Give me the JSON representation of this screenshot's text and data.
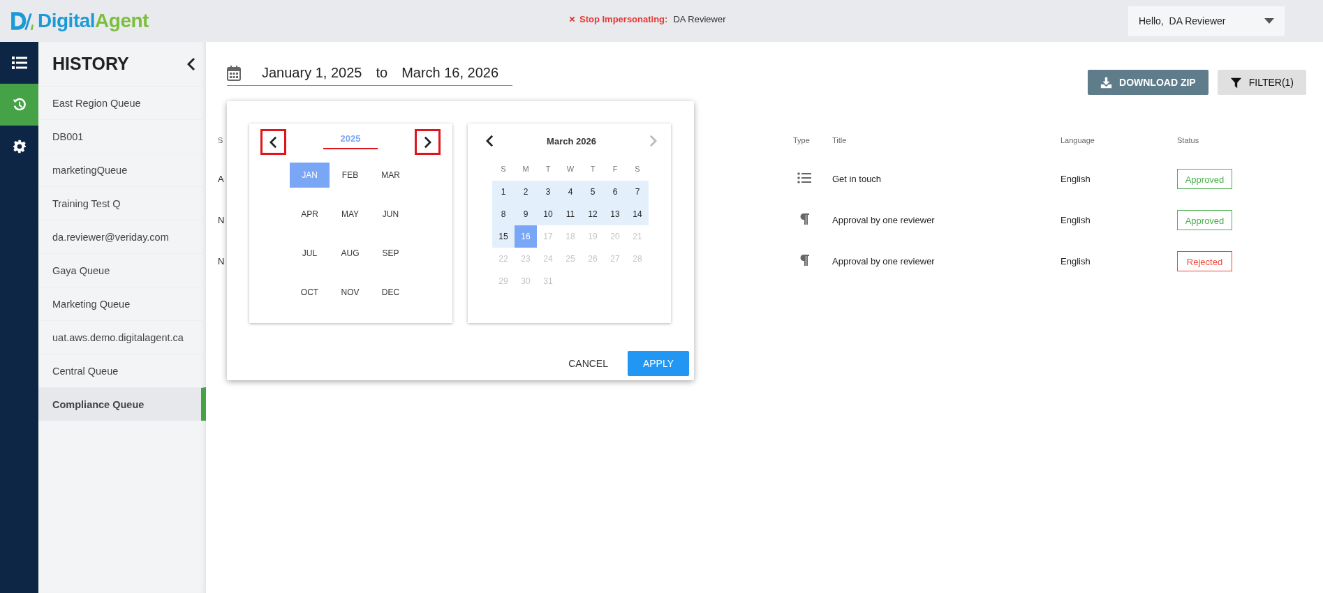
{
  "header": {
    "logo": {
      "parts": [
        "Digital",
        "Agent"
      ]
    },
    "impersonation": {
      "label": "Stop Impersonating:",
      "user": "DA Reviewer"
    },
    "user_menu": {
      "label": "Hello,  DA Reviewer"
    }
  },
  "nav_rail": [
    {
      "kind": "list",
      "selected": false
    },
    {
      "kind": "history",
      "selected": true
    },
    {
      "kind": "settings",
      "selected": false
    }
  ],
  "sidebar": {
    "title": "HISTORY",
    "items": [
      {
        "label": "East Region Queue",
        "selected": false
      },
      {
        "label": "DB001",
        "selected": false
      },
      {
        "label": "marketingQueue",
        "selected": false
      },
      {
        "label": "Training Test Q",
        "selected": false
      },
      {
        "label": "da.reviewer@veriday.com",
        "selected": false
      },
      {
        "label": "Gaya Queue",
        "selected": false
      },
      {
        "label": "Marketing Queue",
        "selected": false
      },
      {
        "label": "uat.aws.demo.digitalagent.ca",
        "selected": false
      },
      {
        "label": "Central Queue",
        "selected": false
      },
      {
        "label": "Compliance Queue",
        "selected": true
      }
    ]
  },
  "date_range": {
    "start": "January 1, 2025",
    "separator": "to",
    "end": "March 16, 2026"
  },
  "buttons": [
    {
      "kind": "download",
      "label": "DOWNLOAD ZIP"
    },
    {
      "kind": "filter",
      "label": "FILTER(1)"
    }
  ],
  "date_picker": {
    "month_view": {
      "year": "2025",
      "year_underlined": true,
      "prev_highlighted": true,
      "next_highlighted": true,
      "months": [
        {
          "label": "JAN",
          "selected": true
        },
        {
          "label": "FEB",
          "selected": false
        },
        {
          "label": "MAR",
          "selected": false
        },
        {
          "label": "APR",
          "selected": false
        },
        {
          "label": "MAY",
          "selected": false
        },
        {
          "label": "JUN",
          "selected": false
        },
        {
          "label": "JUL",
          "selected": false
        },
        {
          "label": "AUG",
          "selected": false
        },
        {
          "label": "SEP",
          "selected": false
        },
        {
          "label": "OCT",
          "selected": false
        },
        {
          "label": "NOV",
          "selected": false
        },
        {
          "label": "DEC",
          "selected": false
        }
      ]
    },
    "day_view": {
      "title": "March 2026",
      "next_disabled": true,
      "weekdays": [
        "S",
        "M",
        "T",
        "W",
        "T",
        "F",
        "S"
      ],
      "days": [
        {
          "day": "1",
          "in_range": true,
          "selected": false,
          "disabled": false
        },
        {
          "day": "2",
          "in_range": true,
          "selected": false,
          "disabled": false
        },
        {
          "day": "3",
          "in_range": true,
          "selected": false,
          "disabled": false
        },
        {
          "day": "4",
          "in_range": true,
          "selected": false,
          "disabled": false
        },
        {
          "day": "5",
          "in_range": true,
          "selected": false,
          "disabled": false
        },
        {
          "day": "6",
          "in_range": true,
          "selected": false,
          "disabled": false
        },
        {
          "day": "7",
          "in_range": true,
          "selected": false,
          "disabled": false
        },
        {
          "day": "8",
          "in_range": true,
          "selected": false,
          "disabled": false
        },
        {
          "day": "9",
          "in_range": true,
          "selected": false,
          "disabled": false
        },
        {
          "day": "10",
          "in_range": true,
          "selected": false,
          "disabled": false
        },
        {
          "day": "11",
          "in_range": true,
          "selected": false,
          "disabled": false
        },
        {
          "day": "12",
          "in_range": true,
          "selected": false,
          "disabled": false
        },
        {
          "day": "13",
          "in_range": true,
          "selected": false,
          "disabled": false
        },
        {
          "day": "14",
          "in_range": true,
          "selected": false,
          "disabled": false
        },
        {
          "day": "15",
          "in_range": true,
          "selected": false,
          "disabled": false
        },
        {
          "day": "16",
          "in_range": true,
          "selected": true,
          "disabled": false
        },
        {
          "day": "17",
          "in_range": false,
          "selected": false,
          "disabled": true
        },
        {
          "day": "18",
          "in_range": false,
          "selected": false,
          "disabled": true
        },
        {
          "day": "19",
          "in_range": false,
          "selected": false,
          "disabled": true
        },
        {
          "day": "20",
          "in_range": false,
          "selected": false,
          "disabled": true
        },
        {
          "day": "21",
          "in_range": false,
          "selected": false,
          "disabled": true
        },
        {
          "day": "22",
          "in_range": false,
          "selected": false,
          "disabled": true
        },
        {
          "day": "23",
          "in_range": false,
          "selected": false,
          "disabled": true
        },
        {
          "day": "24",
          "in_range": false,
          "selected": false,
          "disabled": true
        },
        {
          "day": "25",
          "in_range": false,
          "selected": false,
          "disabled": true
        },
        {
          "day": "26",
          "in_range": false,
          "selected": false,
          "disabled": true
        },
        {
          "day": "27",
          "in_range": false,
          "selected": false,
          "disabled": true
        },
        {
          "day": "28",
          "in_range": false,
          "selected": false,
          "disabled": true
        },
        {
          "day": "29",
          "in_range": false,
          "selected": false,
          "disabled": true
        },
        {
          "day": "30",
          "in_range": false,
          "selected": false,
          "disabled": true
        },
        {
          "day": "31",
          "in_range": false,
          "selected": false,
          "disabled": true
        }
      ]
    },
    "actions": [
      {
        "kind": "cancel",
        "label": "CANCEL"
      },
      {
        "kind": "apply",
        "label": "APPLY"
      }
    ]
  },
  "table": {
    "columns": [
      "S",
      "Type",
      "Title",
      "Language",
      "Status"
    ],
    "rows": [
      {
        "column_1": "A",
        "kind": "list",
        "title": "Get in touch",
        "language": "English",
        "status": {
          "label": "Approved",
          "kind": "approved"
        }
      },
      {
        "column_1": "N",
        "kind": "paragraph",
        "title": "Approval by one reviewer",
        "language": "English",
        "status": {
          "label": "Approved",
          "kind": "approved"
        }
      },
      {
        "column_1": "N",
        "kind": "paragraph",
        "title": "Approval by one reviewer",
        "language": "English",
        "status": {
          "label": "Rejected",
          "kind": "rejected"
        }
      }
    ]
  }
}
